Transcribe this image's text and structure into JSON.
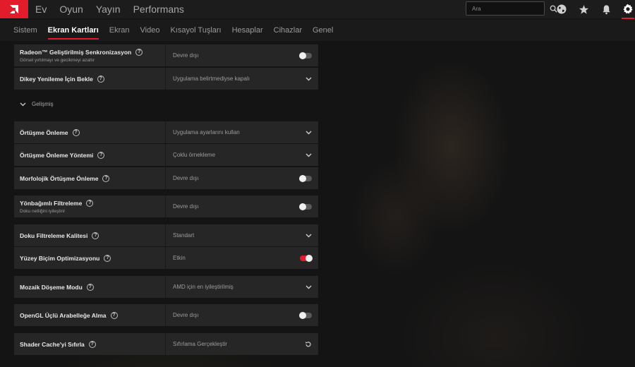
{
  "topbar": {
    "nav": [
      "Ev",
      "Oyun",
      "Yayın",
      "Performans"
    ],
    "search_placeholder": "Ara",
    "icons": [
      "globe-icon",
      "star-icon",
      "bell-icon",
      "gear-icon"
    ]
  },
  "subtabs": {
    "items": [
      "Sistem",
      "Ekran Kartları",
      "Ekran",
      "Video",
      "Kısayol Tuşları",
      "Hesaplar",
      "Cihazlar",
      "Genel"
    ],
    "active": "Ekran Kartları"
  },
  "settings": {
    "rows": [
      {
        "label": "Radeon™ Geliştirilmiş Senkronizasyon",
        "sub": "Görsel yırtılmayı ve gecikmeyi azaltır",
        "value": "Devre dışı",
        "control": "toggle-off"
      },
      {
        "label": "Dikey Yenileme İçin Bekle",
        "value": "Uygulama belirtmediyse kapalı",
        "control": "dropdown"
      },
      {
        "label": "Örtüşme Önleme",
        "value": "Uygulama ayarlarını kullan",
        "control": "dropdown"
      },
      {
        "label": "Örtüşme Önleme Yöntemi",
        "value": "Çoklu örnekleme",
        "control": "dropdown"
      },
      {
        "label": "Morfolojik Örtüşme Önleme",
        "value": "Devre dışı",
        "control": "toggle-off"
      },
      {
        "label": "Yönbağımlı Filtreleme",
        "sub": "Doku netliğini iyileştirir",
        "value": "Devre dışı",
        "control": "toggle-off"
      },
      {
        "label": "Doku Filtreleme Kalitesi",
        "value": "Standart",
        "control": "dropdown"
      },
      {
        "label": "Yüzey Biçim Optimizasyonu",
        "value": "Etkin",
        "control": "toggle-on"
      },
      {
        "label": "Mozaik Döşeme Modu",
        "value": "AMD için en iyileştirilmiş",
        "control": "dropdown"
      },
      {
        "label": "OpenGL Üçlü Arabelleğe Alma",
        "value": "Devre dışı",
        "control": "toggle-off"
      },
      {
        "label": "Shader Cache'yi Sıfırla",
        "value": "Sıfırlama Gerçekleştir",
        "control": "reset"
      }
    ],
    "advanced_label": "Gelişmiş"
  },
  "colors": {
    "accent": "#e21c2a",
    "row_bg": "#262626",
    "topbar_bg": "#1c1c1c"
  }
}
